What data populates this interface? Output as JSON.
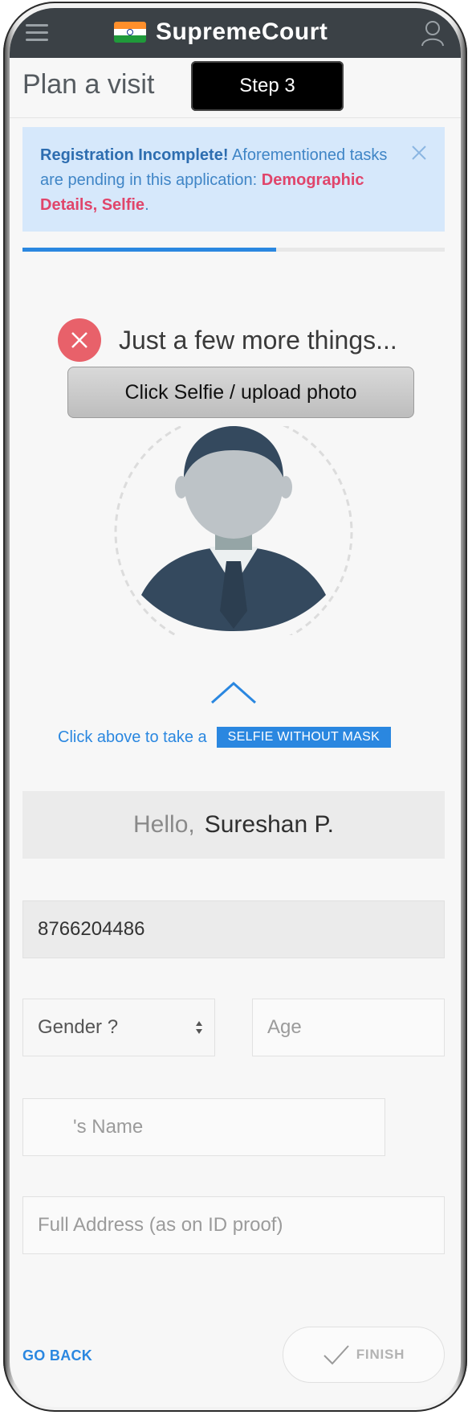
{
  "app": {
    "brand": "SupremeCourt"
  },
  "header": {
    "page_title": "Plan a visit",
    "step_badge": "Step  3"
  },
  "alert": {
    "strong": "Registration Incomplete!",
    "message": " Aforementioned tasks are pending in this application: ",
    "pending": "Demographic Details, Selfie",
    "end": "."
  },
  "progress": {
    "fraction": 0.6
  },
  "selfie_section": {
    "heading": "Just a few more things...",
    "button_label": "Click Selfie / upload photo",
    "hint": "Click above to take a",
    "badge": "SELFIE WITHOUT MASK"
  },
  "greeting": {
    "hello": "Hello,",
    "name": "Sureshan P."
  },
  "form": {
    "phone_value": "8766204486",
    "gender_placeholder": "Gender ?",
    "age_placeholder": "Age",
    "name_placeholder": "'s Name",
    "address_placeholder": "Full Address (as on ID proof)"
  },
  "footer": {
    "back_label": "GO BACK",
    "finish_label": "FINISH"
  },
  "colors": {
    "accent": "#2a87e0",
    "alert_bg": "#d6e8fb",
    "pending_red": "#e0456b",
    "topbar": "#3b4146"
  },
  "icons": {
    "menu": "hamburger-icon",
    "user": "user-icon",
    "flag": "india-flag-icon",
    "close": "close-icon",
    "error": "x-circle-icon",
    "avatar": "person-avatar-icon",
    "up": "chevron-up-icon",
    "finish": "check-icon"
  }
}
